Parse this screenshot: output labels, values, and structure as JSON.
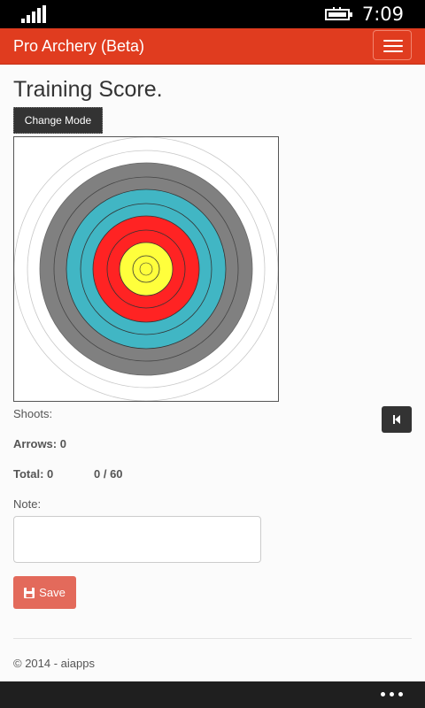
{
  "status_bar": {
    "time": "7:09"
  },
  "app_bar": {
    "title": "Pro Archery (Beta)"
  },
  "page": {
    "title": "Training Score.",
    "change_mode_label": "Change Mode",
    "shoots_label": "Shoots:",
    "arrows_label": "Arrows: 0",
    "total_label": "Total: 0",
    "score_ratio": "0 / 60",
    "note_label": "Note:",
    "note_value": "",
    "save_label": "Save"
  },
  "footer": {
    "copyright": "© 2014 - aiapps"
  },
  "colors": {
    "accent": "#e03c1f",
    "target_white": "#ffffff",
    "target_black": "#808080",
    "target_blue": "#41b6c4",
    "target_red": "#ff2323",
    "target_gold": "#ffff3c"
  },
  "icons": {
    "menu": "hamburger-icon",
    "undo": "skip-back-icon",
    "save": "floppy-disk-icon",
    "more": "ellipsis-icon"
  }
}
